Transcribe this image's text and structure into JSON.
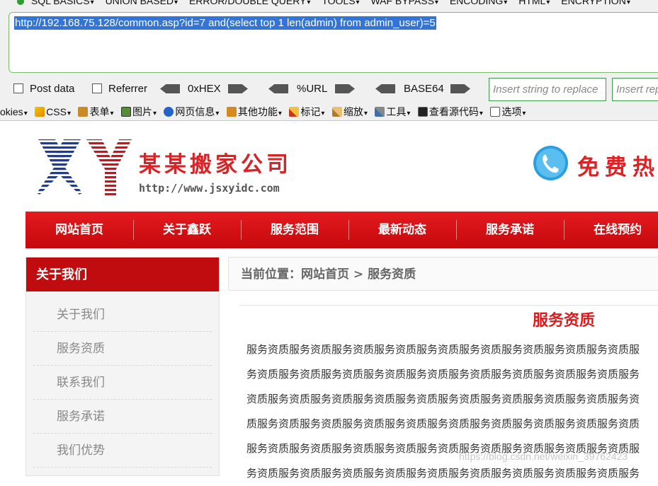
{
  "hackbar": {
    "menus": [
      "SQL BASICS",
      "UNION BASED",
      "ERROR/DOUBLE QUERY",
      "TOOLS",
      "WAF BYPASS",
      "ENCODING",
      "HTML",
      "ENCRYPTION"
    ],
    "url": "http://192.168.75.128/common.asp?id=7 and(select top 1 len(admin) from admin_user)=5",
    "post_data_label": "Post data",
    "referrer_label": "Referrer",
    "hex_label": "0xHEX",
    "url_enc_label": "%URL",
    "base64_label": "BASE64",
    "insert_placeholder": "Insert string to replace",
    "insert_placeholder2": "Insert replacing string"
  },
  "devbar": {
    "items": [
      "okies",
      "CSS",
      "表单",
      "图片",
      "网页信息",
      "其他功能",
      "标记",
      "缩放",
      "工具",
      "查看源代码",
      "选项"
    ]
  },
  "site": {
    "logo_text": "XY",
    "company_name": "某某搬家公司",
    "url": "http://www.jsxyidc.com",
    "hotline": "免费热",
    "nav": [
      "网站首页",
      "关于鑫跃",
      "服务范围",
      "最新动态",
      "服务承诺",
      "在线预约"
    ],
    "sidebar_title": "关于我们",
    "sidebar_items": [
      "关于我们",
      "服务资质",
      "联系我们",
      "服务承诺",
      "我们优势"
    ],
    "breadcrumb": "当前位置：网站首页 > 服务资质",
    "article_title": "服务资质",
    "article_lines": [
      "服务资质服务资质服务资质服务资质服务资质服务资质服务资质服务资质服务资质服",
      "务资质服务资质服务资质服务资质服务资质服务资质服务资质服务资质服务资质服务",
      "资质服务资质服务资质服务资质服务资质服务资质服务资质服务资质服务资质服务资",
      "质服务资质服务资质服务资质服务资质服务资质服务资质服务资质服务资质服务资质",
      "服务资质服务资质服务资质服务资质服务资质服务资质服务资质服务资质服务资质服",
      "务资质服务资质服务资质服务资质服务资质服务资质服务资质服务资质服务资质服务"
    ]
  },
  "watermark": "https://blog.csdn.net/weixin_39762423",
  "colors": {
    "brand_red": "#d82327",
    "nav_red": "#e41b1f",
    "highlight": "#3374d6",
    "hackbar_border": "#3d9a4d"
  }
}
